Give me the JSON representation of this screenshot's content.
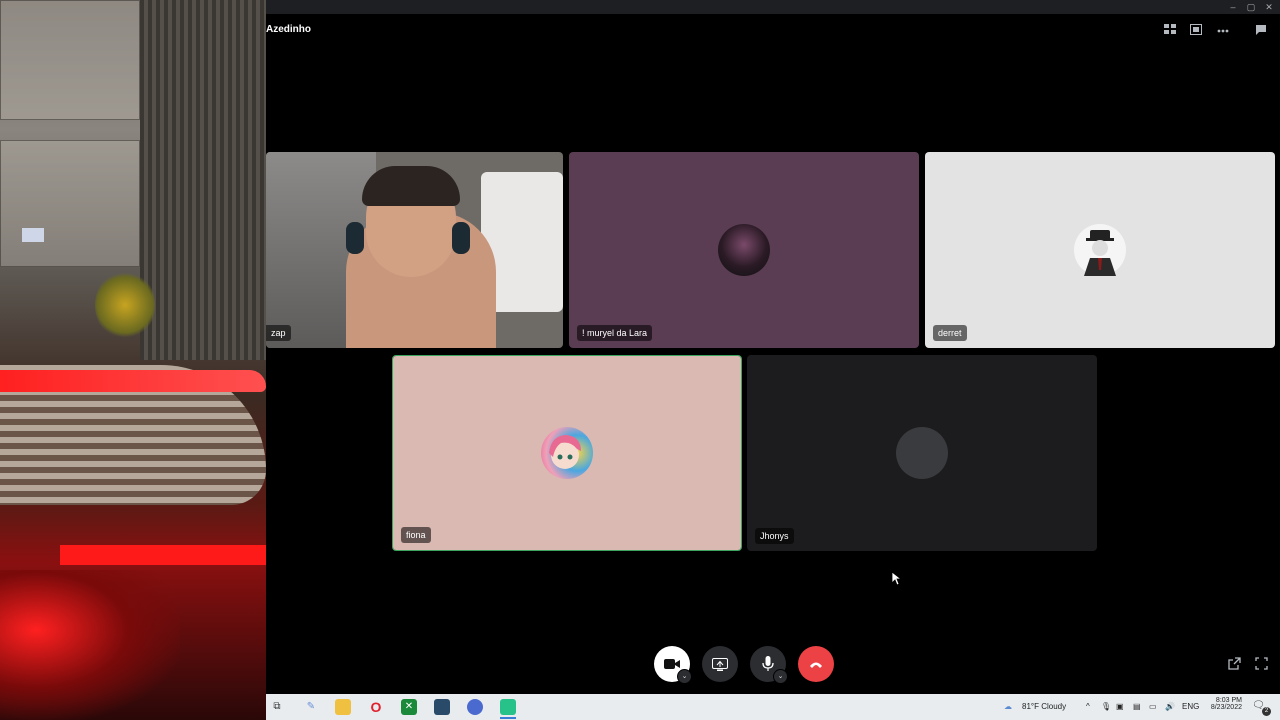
{
  "window": {
    "title": "Azedinho",
    "controls": {
      "minimize": "–",
      "maximize": "▢",
      "close": "✕"
    }
  },
  "topbar": {
    "icons": [
      "grid-layout-icon",
      "popout-icon",
      "more-icon",
      "chat-icon"
    ]
  },
  "participants": [
    {
      "name": "zap",
      "type": "video"
    },
    {
      "name": "! muryel da Lara",
      "type": "avatar",
      "bg": "#5a3d52"
    },
    {
      "name": "derret",
      "type": "avatar",
      "bg": "#e3e3e3"
    },
    {
      "name": "fiona",
      "type": "avatar",
      "bg": "#d9b9b2",
      "speaking": true
    },
    {
      "name": "Jhonys",
      "type": "avatar",
      "bg": "#1c1c1e"
    }
  ],
  "controls": {
    "items": [
      "camera-button",
      "screen-share-button",
      "microphone-button",
      "disconnect-button"
    ],
    "colors": {
      "disconnect": "#ed4245",
      "button": "#2b2d31",
      "camera": "#ffffff"
    }
  },
  "taskbar": {
    "weather": "81°F  Cloudy",
    "language": "ENG",
    "time": "8:03 PM",
    "date": "8/23/2022",
    "notification_count": "2"
  }
}
